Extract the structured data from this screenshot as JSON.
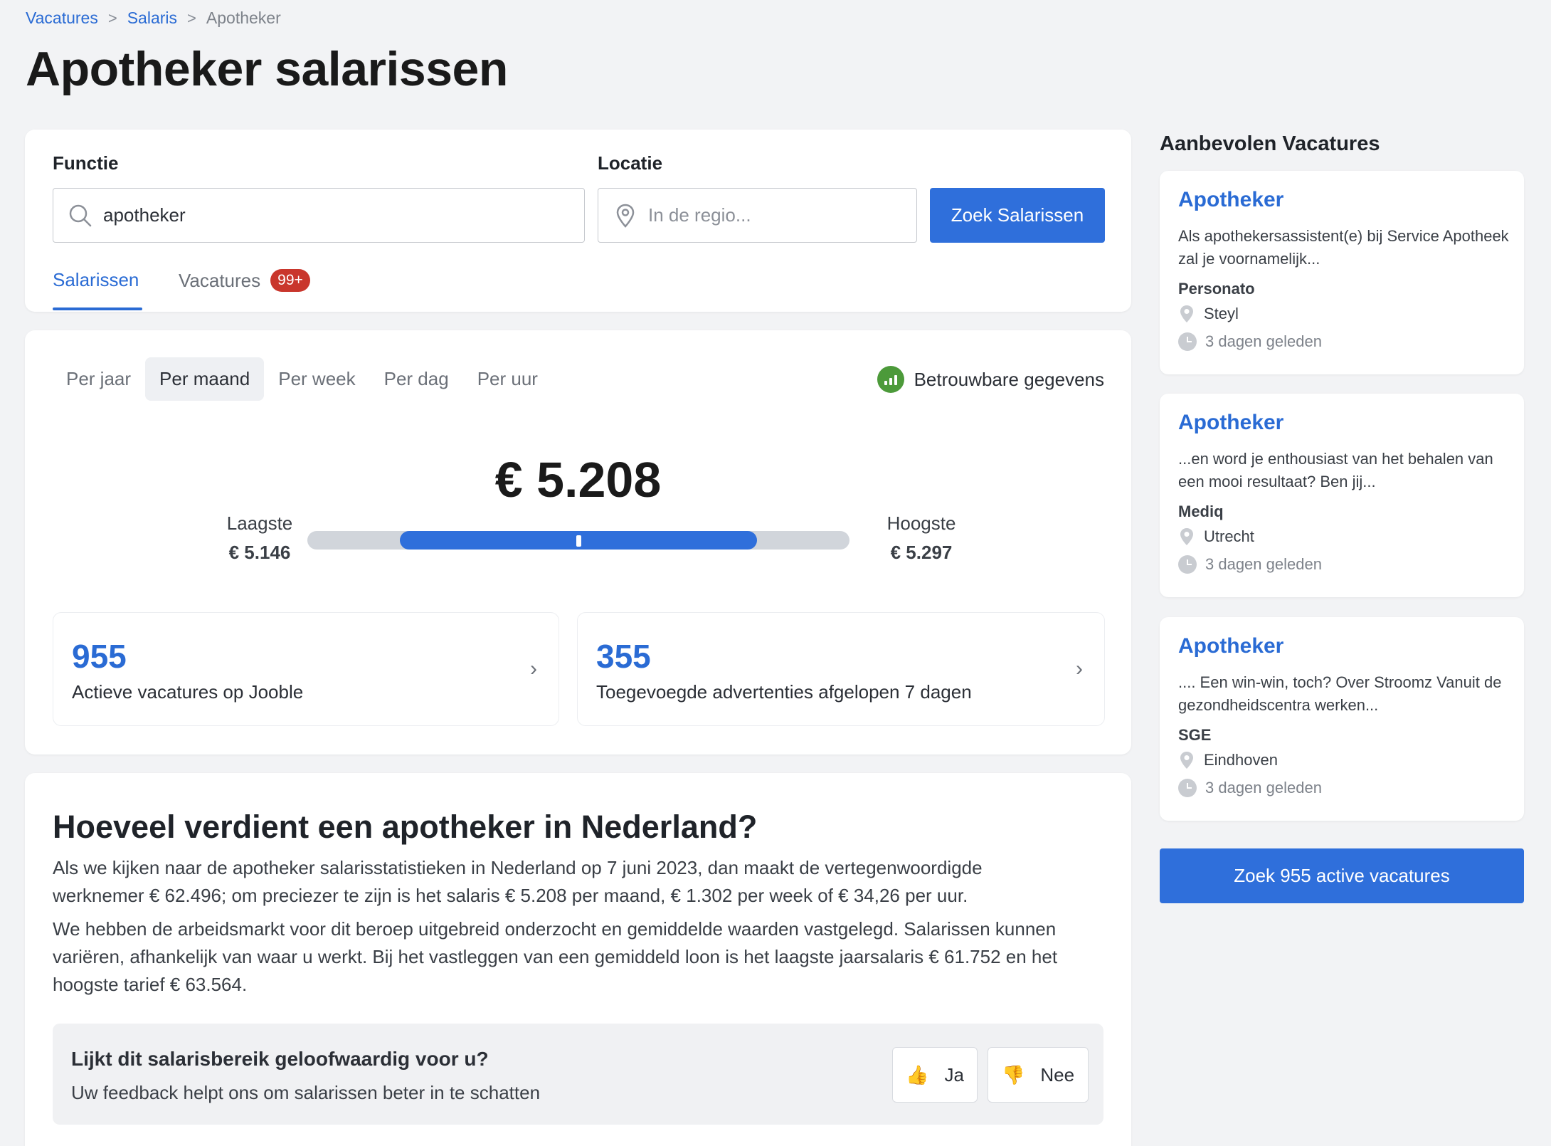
{
  "breadcrumb": {
    "items": [
      "Vacatures",
      "Salaris"
    ],
    "current": "Apotheker",
    "separator": ">"
  },
  "page_title": "Apotheker salarissen",
  "search": {
    "function_label": "Functie",
    "function_value": "apotheker",
    "location_label": "Locatie",
    "location_placeholder": "In de regio...",
    "button_label": "Zoek Salarissen",
    "tabs": [
      {
        "label": "Salarissen",
        "active": true
      },
      {
        "label": "Vacatures",
        "badge": "99+"
      }
    ]
  },
  "salary": {
    "periods": [
      "Per jaar",
      "Per maand",
      "Per week",
      "Per dag",
      "Per uur"
    ],
    "active_period": "Per maand",
    "reliable_label": "Betrouwbare gegevens",
    "main_value": "€ 5.208",
    "low_label": "Laagste",
    "low_value": "€ 5.146",
    "high_label": "Hoogste",
    "high_value": "€ 5.297",
    "range_fill_start": 0.17,
    "range_fill_end": 0.83,
    "range_marker": 0.5,
    "stats": [
      {
        "number": "955",
        "text": "Actieve vacatures op Jooble"
      },
      {
        "number": "355",
        "text": "Toegevoegde advertenties afgelopen 7 dagen"
      }
    ]
  },
  "article": {
    "title": "Hoeveel verdient een apotheker in Nederland?",
    "p1": "Als we kijken naar de apotheker salarisstatistieken in Nederland op 7 juni 2023, dan maakt de vertegenwoordigde werknemer € 62.496; om preciezer te zijn is het salaris € 5.208 per maand, € 1.302 per week of € 34,26 per uur.",
    "p2": "We hebben de arbeidsmarkt voor dit beroep uitgebreid onderzocht en gemiddelde waarden vastgelegd. Salarissen kunnen variëren, afhankelijk van waar u werkt. Bij het vastleggen van een gemiddeld loon is het laagste jaarsalaris € 61.752 en het hoogste tarief € 63.564.",
    "feedback_question": "Lijkt dit salarisbereik geloofwaardig voor u?",
    "feedback_sub": "Uw feedback helpt ons om salarissen beter in te schatten",
    "yes_label": "Ja",
    "no_label": "Nee"
  },
  "sidebar": {
    "title": "Aanbevolen Vacatures",
    "jobs": [
      {
        "title": "Apotheker",
        "desc": "Als apothekersassistent(e) bij Service Apotheek zal je voornamelijk...",
        "company": "Personato",
        "location": "Steyl",
        "time": "3 dagen geleden"
      },
      {
        "title": "Apotheker",
        "desc": "...en word je enthousiast van het behalen van een mooi resultaat? Ben jij...",
        "company": "Mediq",
        "location": "Utrecht",
        "time": "3 dagen geleden"
      },
      {
        "title": "Apotheker",
        "desc": ".... Een win-win, toch? Over Stroomz Vanuit de gezondheidscentra werken...",
        "company": "SGE",
        "location": "Eindhoven",
        "time": "3 dagen geleden"
      }
    ],
    "button_label": "Zoek 955 active vacatures"
  },
  "colors": {
    "accent": "#2f6fdb",
    "link": "#2a6bd4",
    "badge": "#c9362c",
    "reliable": "#4c9a3a",
    "background": "#f2f3f5"
  }
}
